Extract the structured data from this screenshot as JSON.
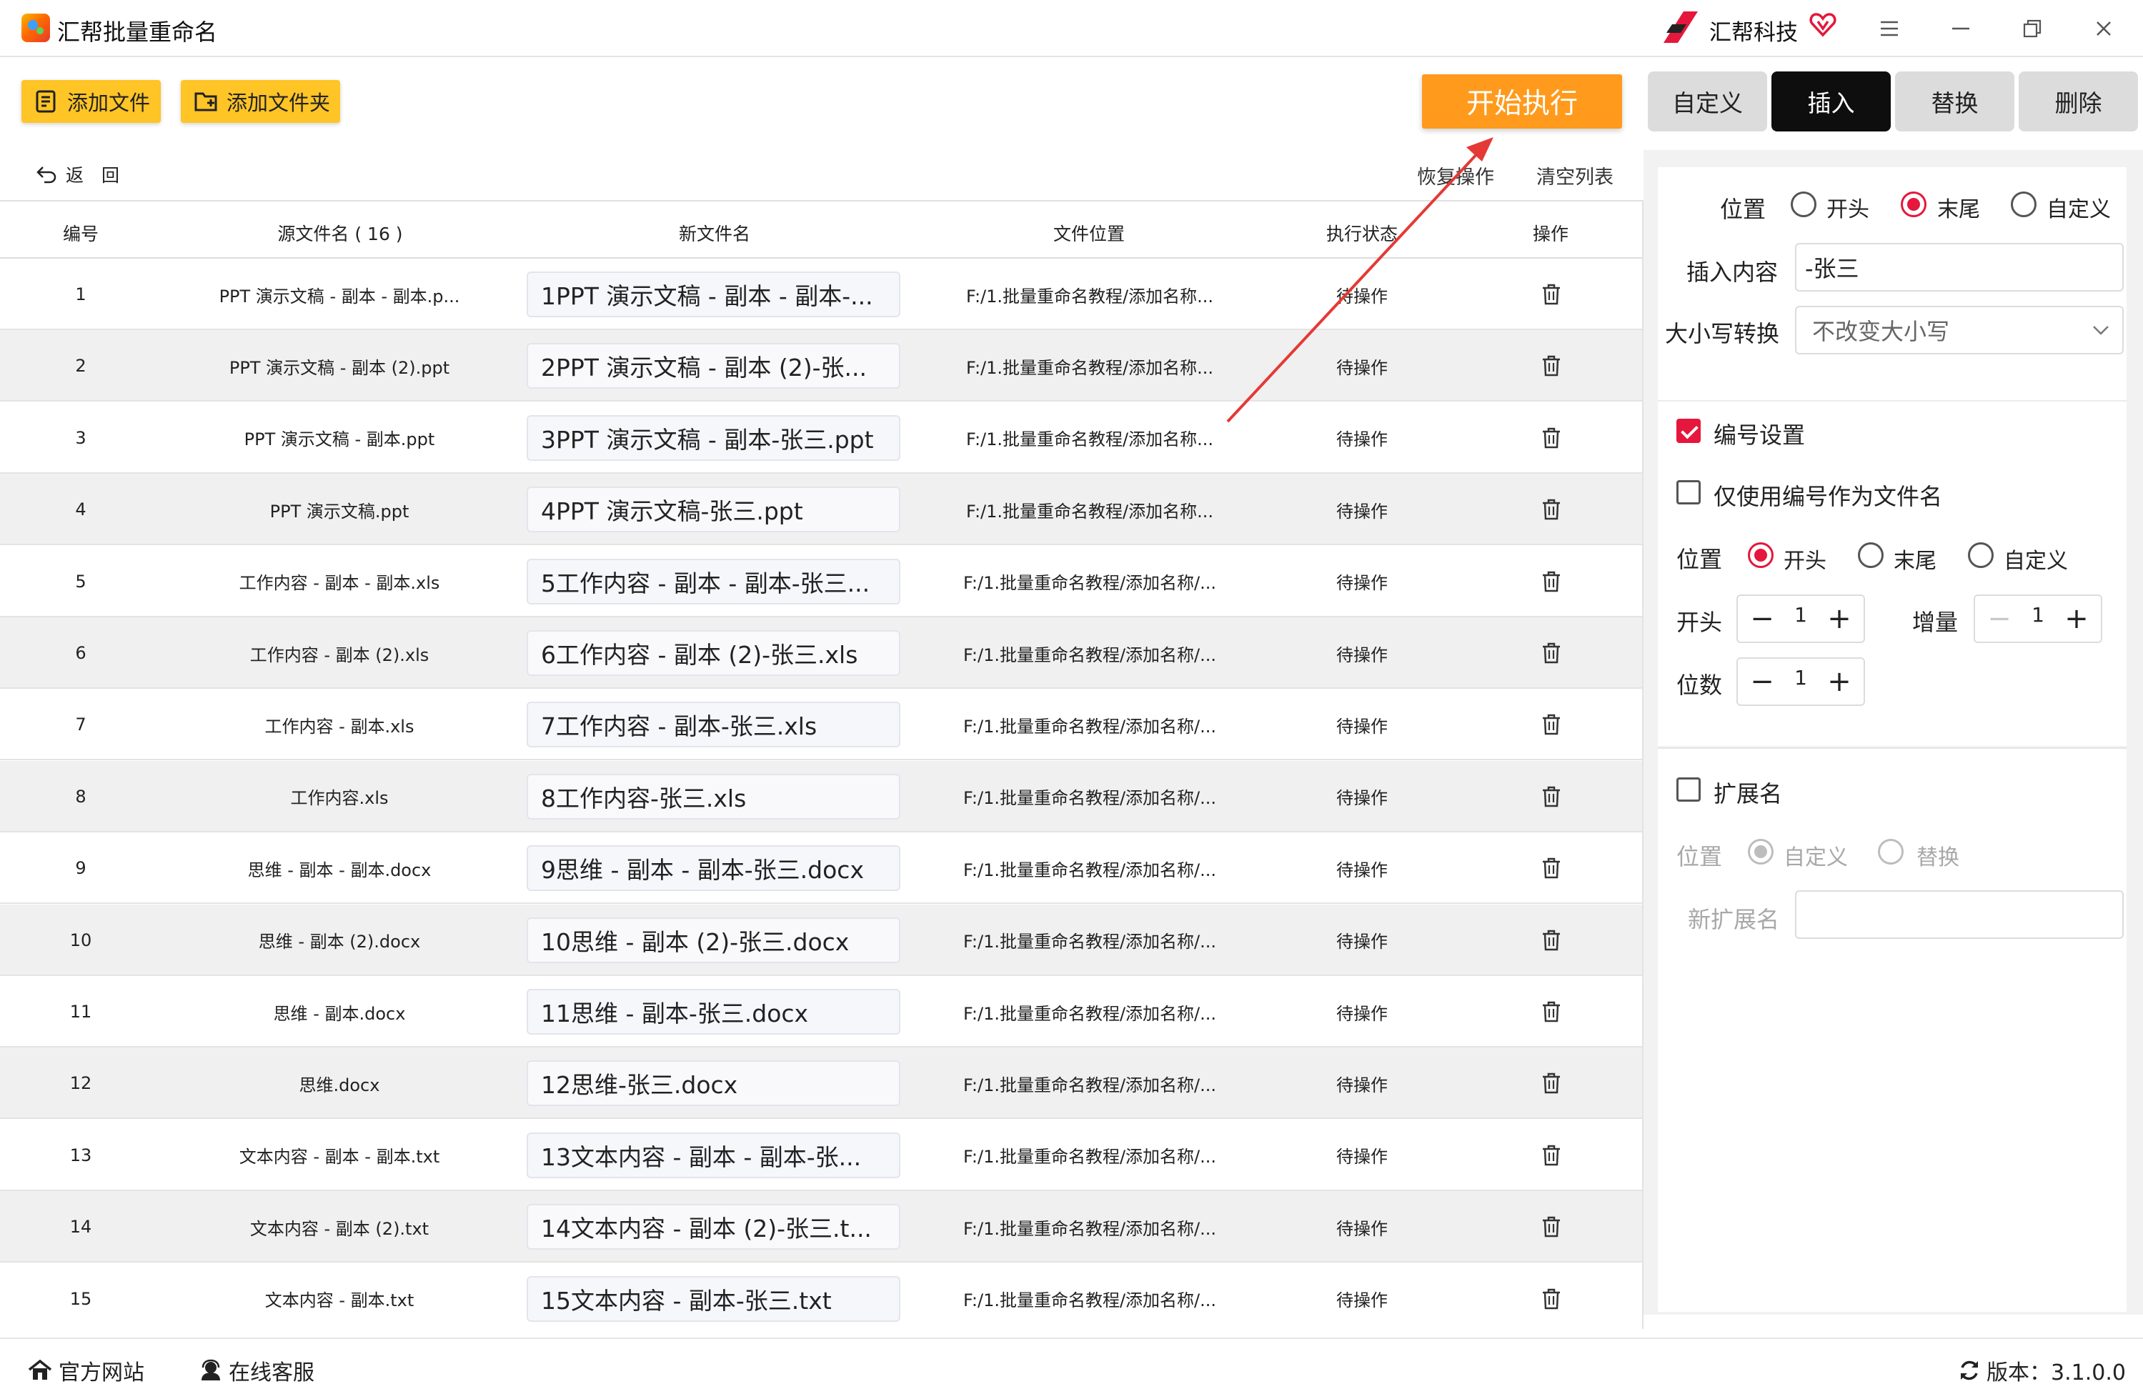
{
  "window": {
    "title": "汇帮批量重命名",
    "brand": "汇帮科技",
    "icons": [
      "app-logo-icon",
      "brand-logo-icon",
      "vip-heart-icon",
      "menu-icon",
      "minimize-icon",
      "maximize-icon",
      "close-icon"
    ]
  },
  "toolbar": {
    "add_file": "添加文件",
    "add_folder": "添加文件夹",
    "start": "开始执行",
    "back": "返　回",
    "restore": "恢复操作",
    "clear": "清空列表"
  },
  "tabs": [
    {
      "label": "自定义",
      "active": false
    },
    {
      "label": "插入",
      "active": true
    },
    {
      "label": "替换",
      "active": false
    },
    {
      "label": "删除",
      "active": false
    }
  ],
  "table": {
    "headers": {
      "index": "编号",
      "source": "源文件名 ( 16 )",
      "new_name": "新文件名",
      "location": "文件位置",
      "status": "执行状态",
      "action": "操作"
    },
    "rows": [
      {
        "index": "1",
        "source": "PPT 演示文稿 - 副本 - 副本.p...",
        "new_name": "1PPT 演示文稿 - 副本 - 副本-...",
        "location": "F:/1.批量重命名教程/添加名称...",
        "status": "待操作"
      },
      {
        "index": "2",
        "source": "PPT 演示文稿 - 副本 (2).ppt",
        "new_name": "2PPT 演示文稿 - 副本 (2)-张...",
        "location": "F:/1.批量重命名教程/添加名称...",
        "status": "待操作"
      },
      {
        "index": "3",
        "source": "PPT 演示文稿 - 副本.ppt",
        "new_name": "3PPT 演示文稿 - 副本-张三.ppt",
        "location": "F:/1.批量重命名教程/添加名称...",
        "status": "待操作"
      },
      {
        "index": "4",
        "source": "PPT 演示文稿.ppt",
        "new_name": "4PPT 演示文稿-张三.ppt",
        "location": "F:/1.批量重命名教程/添加名称...",
        "status": "待操作"
      },
      {
        "index": "5",
        "source": "工作内容 - 副本 - 副本.xls",
        "new_name": "5工作内容 - 副本 - 副本-张三...",
        "location": "F:/1.批量重命名教程/添加名称/...",
        "status": "待操作"
      },
      {
        "index": "6",
        "source": "工作内容 - 副本 (2).xls",
        "new_name": "6工作内容 - 副本 (2)-张三.xls",
        "location": "F:/1.批量重命名教程/添加名称/...",
        "status": "待操作"
      },
      {
        "index": "7",
        "source": "工作内容 - 副本.xls",
        "new_name": "7工作内容 - 副本-张三.xls",
        "location": "F:/1.批量重命名教程/添加名称/...",
        "status": "待操作"
      },
      {
        "index": "8",
        "source": "工作内容.xls",
        "new_name": "8工作内容-张三.xls",
        "location": "F:/1.批量重命名教程/添加名称/...",
        "status": "待操作"
      },
      {
        "index": "9",
        "source": "思维 - 副本 - 副本.docx",
        "new_name": "9思维 - 副本 - 副本-张三.docx",
        "location": "F:/1.批量重命名教程/添加名称/...",
        "status": "待操作"
      },
      {
        "index": "10",
        "source": "思维 - 副本 (2).docx",
        "new_name": "10思维 - 副本 (2)-张三.docx",
        "location": "F:/1.批量重命名教程/添加名称/...",
        "status": "待操作"
      },
      {
        "index": "11",
        "source": "思维 - 副本.docx",
        "new_name": "11思维 - 副本-张三.docx",
        "location": "F:/1.批量重命名教程/添加名称/...",
        "status": "待操作"
      },
      {
        "index": "12",
        "source": "思维.docx",
        "new_name": "12思维-张三.docx",
        "location": "F:/1.批量重命名教程/添加名称/...",
        "status": "待操作"
      },
      {
        "index": "13",
        "source": "文本内容 - 副本 - 副本.txt",
        "new_name": "13文本内容 - 副本 - 副本-张...",
        "location": "F:/1.批量重命名教程/添加名称/...",
        "status": "待操作"
      },
      {
        "index": "14",
        "source": "文本内容 - 副本 (2).txt",
        "new_name": "14文本内容 - 副本 (2)-张三.t...",
        "location": "F:/1.批量重命名教程/添加名称/...",
        "status": "待操作"
      },
      {
        "index": "15",
        "source": "文本内容 - 副本.txt",
        "new_name": "15文本内容 - 副本-张三.txt",
        "location": "F:/1.批量重命名教程/添加名称/...",
        "status": "待操作"
      }
    ]
  },
  "panel": {
    "position_label": "位置",
    "position_options": [
      "开头",
      "末尾",
      "自定义"
    ],
    "position_selected": "末尾",
    "insert_label": "插入内容",
    "insert_value": "-张三",
    "case_label": "大小写转换",
    "case_value": "不改变大小写",
    "numbering": {
      "enable_label": "编号设置",
      "enabled": true,
      "only_number_label": "仅使用编号作为文件名",
      "only_number": false,
      "position_label": "位置",
      "position_options": [
        "开头",
        "末尾",
        "自定义"
      ],
      "position_selected": "开头",
      "start_label": "开头",
      "start_value": "1",
      "increment_label": "增量",
      "increment_value": "1",
      "digits_label": "位数",
      "digits_value": "1"
    },
    "extension": {
      "enable_label": "扩展名",
      "enabled": false,
      "position_label": "位置",
      "position_options": [
        "自定义",
        "替换"
      ],
      "position_selected": "自定义",
      "new_ext_label": "新扩展名",
      "new_ext_value": ""
    }
  },
  "statusbar": {
    "website": "官方网站",
    "support": "在线客服",
    "version": "版本：3.1.0.0"
  },
  "colors": {
    "accent": "#e5173c",
    "start_button": "#ff9a1c",
    "toolbar_button": "#ffc426",
    "active_tab": "#0e0e0e",
    "annotation_arrow": "#e53935"
  }
}
